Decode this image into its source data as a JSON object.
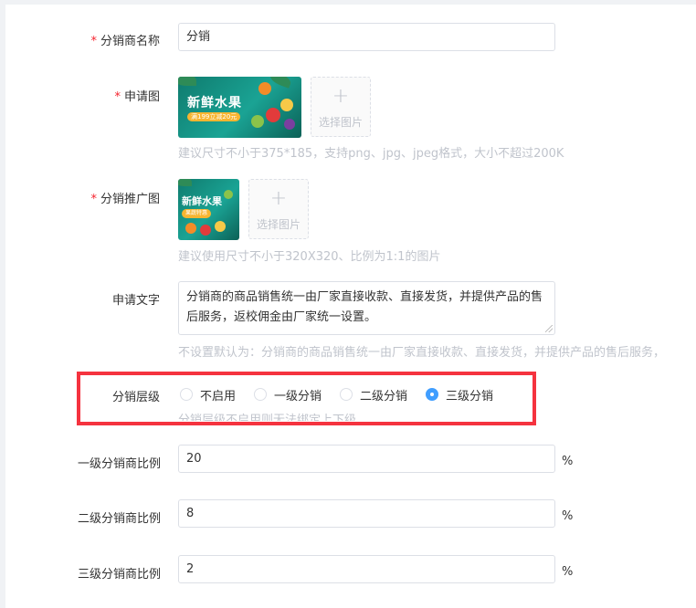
{
  "form": {
    "name_label": "分销商名称",
    "name_value": "分销",
    "apply_image_label": "申请图",
    "apply_image": {
      "title": "新鲜水果",
      "badge": "满199立减20元"
    },
    "upload_plus": "+",
    "upload_text": "选择图片",
    "apply_image_hint": "建议尺寸不小于375*185，支持png、jpg、jpeg格式，大小不超过200K",
    "promo_image_label": "分销推广图",
    "promo_image": {
      "title": "新鲜水果",
      "badge": "果蔬特惠"
    },
    "promo_image_hint": "建议使用尺寸不小于320X320、比例为1:1的图片",
    "apply_text_label": "申请文字",
    "apply_text_value": "分销商的商品销售统一由厂家直接收款、直接发货，并提供产品的售后服务，返校佣金由厂家统一设置。",
    "apply_text_hint": "不设置默认为：分销商的商品销售统一由厂家直接收款、直接发货，并提供产品的售后服务，",
    "level_label": "分销层级",
    "level_options": [
      "不启用",
      "一级分销",
      "二级分销",
      "三级分销"
    ],
    "level_selected": "三级分销",
    "level_hint": "分销层级不启用则无法绑定上下级",
    "level1_label": "一级分销商比例",
    "level1_value": "20",
    "level2_label": "二级分销商比例",
    "level2_value": "8",
    "level3_label": "三级分销商比例",
    "level3_value": "2",
    "percent_unit": "%"
  },
  "colors": {
    "required": "#f5222d",
    "radio_checked": "#409eff",
    "highlight_box": "#f5333f",
    "hint_text": "#c0c4cc"
  }
}
